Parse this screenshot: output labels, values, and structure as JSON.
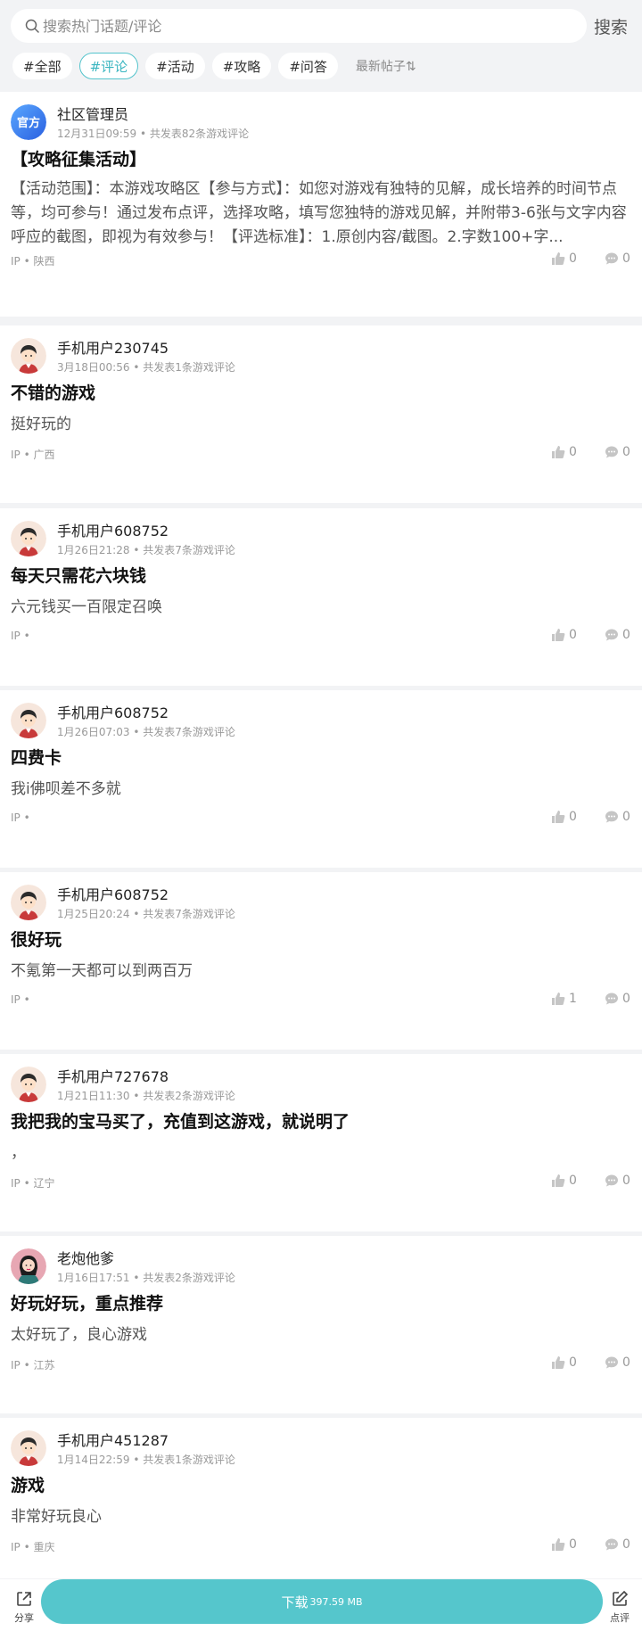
{
  "search": {
    "placeholder": "搜索热门话题/评论",
    "button_label": "搜索"
  },
  "filters": [
    {
      "label": "#全部",
      "active": false
    },
    {
      "label": "#评论",
      "active": true
    },
    {
      "label": "#活动",
      "active": false
    },
    {
      "label": "#攻略",
      "active": false
    },
    {
      "label": "#问答",
      "active": false
    }
  ],
  "sort_label": "最新帖子⇅",
  "posts": [
    {
      "user": "社区管理员",
      "avatar": "official",
      "time": "12月31日09:59",
      "count_text": "共发表82条游戏评论",
      "title": "【攻略征集活动】",
      "body": "【活动范围】：本游戏攻略区【参与方式】：如您对游戏有独特的见解，成长培养的时间节点等，均可参与！通过发布点评，选择攻略，填写您独特的游戏见解，并附带3-6张与文字内容呼应的截图，即视为有效参与！【评选标准】：1.原创内容/截图。2.字数100+字...",
      "ip": "IP • 陕西",
      "likes": "0",
      "comments": "0"
    },
    {
      "user": "手机用户230745",
      "avatar": "boy",
      "time": "3月18日00:56",
      "count_text": "共发表1条游戏评论",
      "title": "不错的游戏",
      "body": "挺好玩的",
      "ip": "IP • 广西",
      "likes": "0",
      "comments": "0"
    },
    {
      "user": "手机用户608752",
      "avatar": "boy",
      "time": "1月26日21:28",
      "count_text": "共发表7条游戏评论",
      "title": "每天只需花六块钱",
      "body": "六元钱买一百限定召唤",
      "ip": "IP •",
      "likes": "0",
      "comments": "0"
    },
    {
      "user": "手机用户608752",
      "avatar": "boy",
      "time": "1月26日07:03",
      "count_text": "共发表7条游戏评论",
      "title": "四费卡",
      "body": "我i佛呗差不多就",
      "ip": "IP •",
      "likes": "0",
      "comments": "0"
    },
    {
      "user": "手机用户608752",
      "avatar": "boy",
      "time": "1月25日20:24",
      "count_text": "共发表7条游戏评论",
      "title": "很好玩",
      "body": "不氪第一天都可以到两百万",
      "ip": "IP •",
      "likes": "1",
      "comments": "0"
    },
    {
      "user": "手机用户727678",
      "avatar": "boy",
      "time": "1月21日11:30",
      "count_text": "共发表2条游戏评论",
      "title": "我把我的宝马买了，充值到这游戏，就说明了",
      "body": "，",
      "ip": "IP • 辽宁",
      "likes": "0",
      "comments": "0"
    },
    {
      "user": "老炮他爹",
      "avatar": "girl",
      "time": "1月16日17:51",
      "count_text": "共发表2条游戏评论",
      "title": "好玩好玩，重点推荐",
      "body": "太好玩了，良心游戏",
      "ip": "IP • 江苏",
      "likes": "0",
      "comments": "0"
    },
    {
      "user": "手机用户451287",
      "avatar": "boy",
      "time": "1月14日22:59",
      "count_text": "共发表1条游戏评论",
      "title": "游戏",
      "body": "非常好玩良心",
      "ip": "IP • 重庆",
      "likes": "0",
      "comments": "0"
    }
  ],
  "bottom_bar": {
    "share_label": "分享",
    "download_label": "下载",
    "download_size": "397.59 MB",
    "review_label": "点评"
  },
  "colors": {
    "accent": "#55c6cc",
    "background": "#f2f3f5"
  }
}
